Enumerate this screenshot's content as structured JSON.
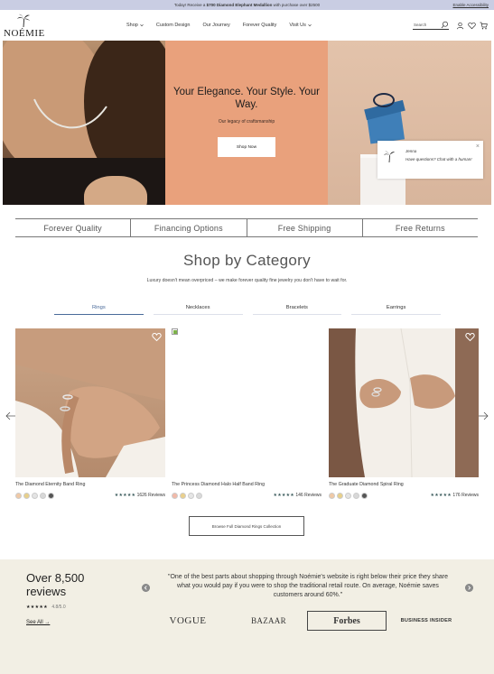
{
  "announcement": {
    "prefix": "Today! Receive a",
    "bold": "$700 Diamond Elephant Medallion",
    "suffix": "with purchase over $2500",
    "accessibility": "Enable Accessibility"
  },
  "header": {
    "logo": "NOÉMIE",
    "nav": [
      {
        "label": "Shop",
        "has_dropdown": true
      },
      {
        "label": "Custom Design",
        "has_dropdown": false
      },
      {
        "label": "Our Journey",
        "has_dropdown": false
      },
      {
        "label": "Forever Quality",
        "has_dropdown": false
      },
      {
        "label": "Visit Us",
        "has_dropdown": true
      }
    ],
    "search_placeholder": "Search",
    "icons": [
      "search-icon",
      "account-icon",
      "wishlist-icon",
      "cart-icon"
    ]
  },
  "hero": {
    "title": "Your Elegance. Your Style. Your Way.",
    "subtitle": "Our legacy of craftsmanship",
    "cta": "Shop Now"
  },
  "chat": {
    "name": "Jenna",
    "message": "Have questions? Chat with a human!",
    "close": "×"
  },
  "features": [
    "Forever Quality",
    "Financing Options",
    "Free Shipping",
    "Free Returns"
  ],
  "category": {
    "title": "Shop by Category",
    "subtitle": "Luxury doesn't mean overpriced – we make forever quality fine jewelry you don't have to wait for.",
    "tabs": [
      {
        "label": "Rings",
        "active": true
      },
      {
        "label": "Necklaces",
        "active": false
      },
      {
        "label": "Bracelets",
        "active": false
      },
      {
        "label": "Earrings",
        "active": false
      }
    ]
  },
  "products": [
    {
      "name": "The Diamond Eternity Band Ring",
      "reviews": "1626 Reviews",
      "stars": "★★★★★",
      "swatches": [
        "#f0c9a6",
        "#e8d08a",
        "#e4e4e4",
        "#d8d8d8",
        "#555555"
      ]
    },
    {
      "name": "The Princess Diamond Halo Half Band Ring",
      "reviews": "146 Reviews",
      "stars": "★★★★★",
      "swatches": [
        "#f2b9a8",
        "#ead08c",
        "#e6e6e6",
        "#dadada"
      ]
    },
    {
      "name": "The Graduate Diamond Spiral Ring",
      "reviews": "176 Reviews",
      "stars": "★★★★★",
      "swatches": [
        "#f0c9a6",
        "#e8d08a",
        "#e4e4e4",
        "#d8d8d8",
        "#555555"
      ]
    }
  ],
  "browse": "Browse Full Diamond Rings Collection",
  "reviews": {
    "count": "Over 8,500 reviews",
    "stars": "★★★★★",
    "score": "4.8/5.0",
    "link": "See All →",
    "quote": "\"One of the best parts about shopping through Noémie's website is right below their price they share what you would pay if you were to shop the traditional retail route. On average, Noémie saves customers around 60%.\"",
    "press": [
      "VOGUE",
      "BAZAAR",
      "Forbes",
      "BUSINESS INSIDER"
    ]
  },
  "colors": {
    "announcement_bg": "#c9cde3",
    "hero_panel": "#e9a17c",
    "accent_blue": "#4a6b9a",
    "reviews_bg": "#f2efe4"
  }
}
